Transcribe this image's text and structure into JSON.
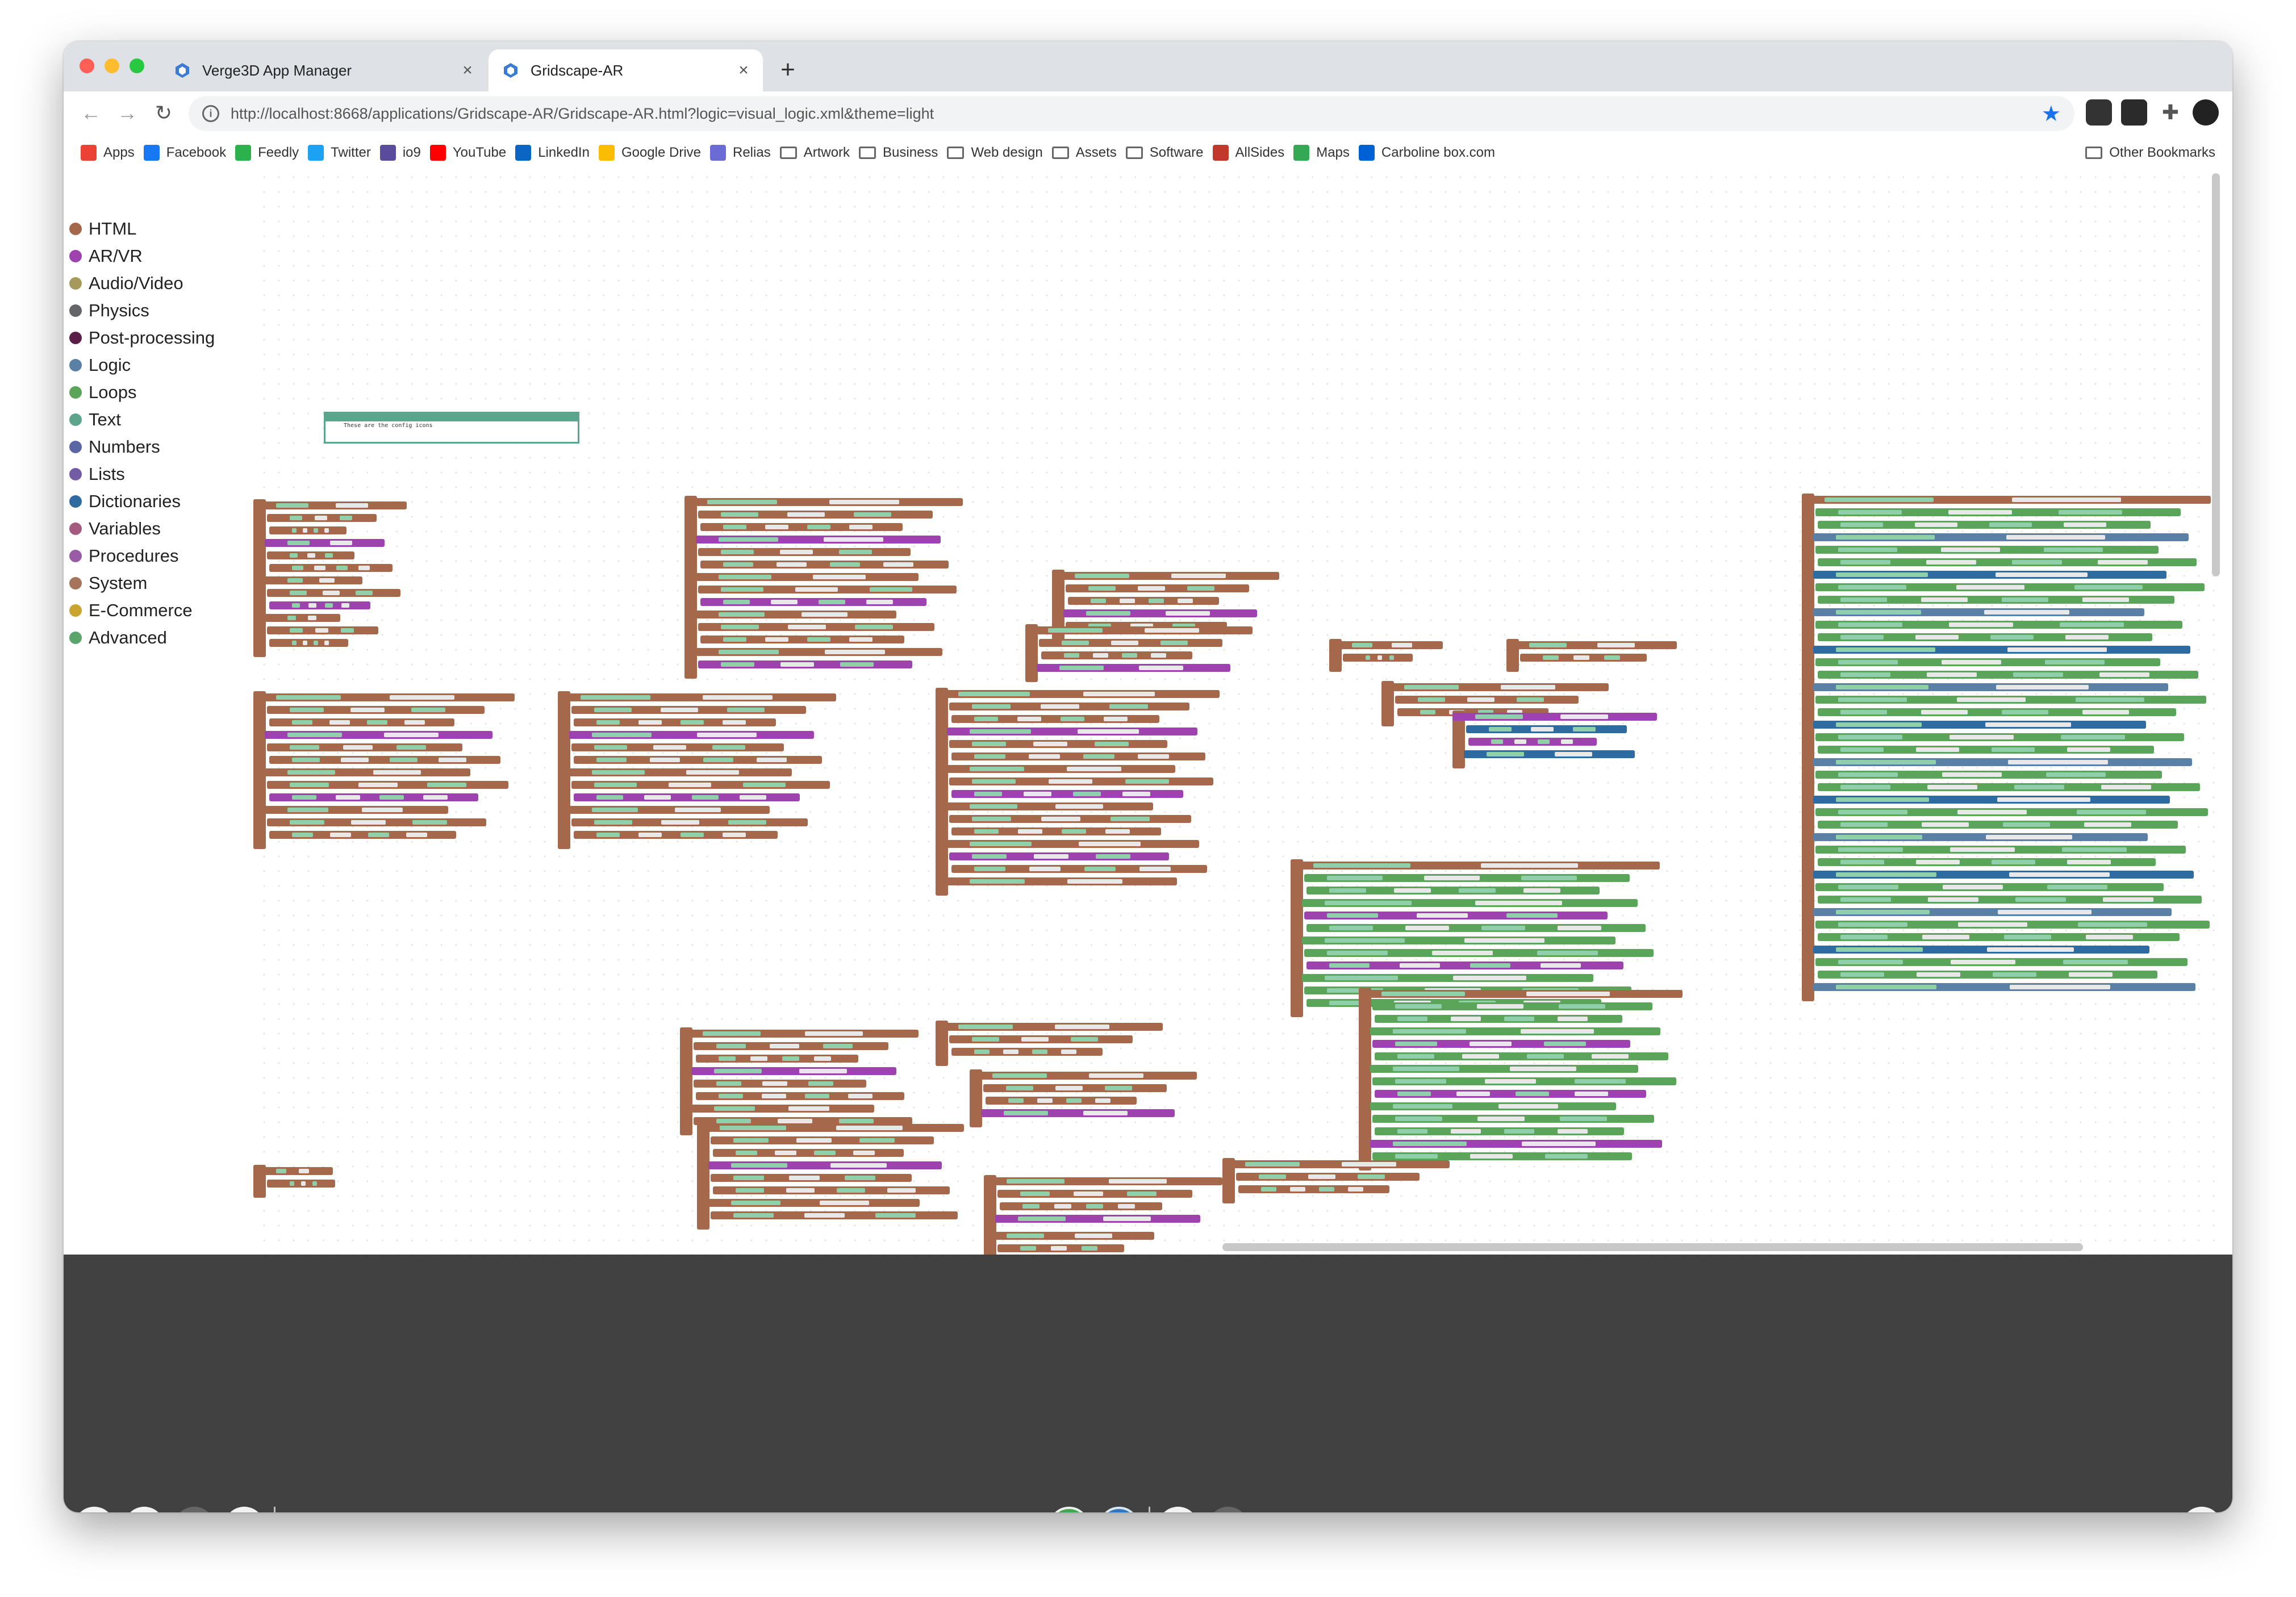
{
  "tabs": [
    {
      "title": "Verge3D App Manager",
      "close": "×"
    },
    {
      "title": "Gridscape-AR",
      "close": "×"
    }
  ],
  "new_tab": "+",
  "address_bar": {
    "url": "http://localhost:8668/applications/Gridscape-AR/Gridscape-AR.html?logic=visual_logic.xml&theme=light"
  },
  "bookmarks": [
    {
      "label": "Apps",
      "color": "#ea4335"
    },
    {
      "label": "Facebook",
      "color": "#1877f2"
    },
    {
      "label": "Feedly",
      "color": "#2bb24c"
    },
    {
      "label": "Twitter",
      "color": "#1da1f2"
    },
    {
      "label": "io9",
      "color": "#5b4b9c"
    },
    {
      "label": "YouTube",
      "color": "#ff0000"
    },
    {
      "label": "LinkedIn",
      "color": "#0a66c2"
    },
    {
      "label": "Google Drive",
      "color": "#fbbc04"
    },
    {
      "label": "Relias",
      "color": "#6b6bd6"
    },
    {
      "label": "Artwork",
      "folder": true
    },
    {
      "label": "Business",
      "folder": true
    },
    {
      "label": "Web design",
      "folder": true
    },
    {
      "label": "Assets",
      "folder": true
    },
    {
      "label": "Software",
      "folder": true
    },
    {
      "label": "AllSides",
      "color": "#c0392b"
    },
    {
      "label": "Maps",
      "color": "#34a853"
    },
    {
      "label": "Carboline box.com",
      "color": "#0061d5"
    }
  ],
  "other_bookmarks": "Other Bookmarks",
  "categories": [
    {
      "label": "HTML",
      "color": "#a5684b"
    },
    {
      "label": "AR/VR",
      "color": "#9e42b0"
    },
    {
      "label": "Audio/Video",
      "color": "#a59a5b"
    },
    {
      "label": "Physics",
      "color": "#64656a"
    },
    {
      "label": "Post-processing",
      "color": "#5a1e49"
    },
    {
      "label": "Logic",
      "color": "#5b80a5"
    },
    {
      "label": "Loops",
      "color": "#5ba55b"
    },
    {
      "label": "Text",
      "color": "#5ba58c"
    },
    {
      "label": "Numbers",
      "color": "#5b67a5"
    },
    {
      "label": "Lists",
      "color": "#745ba5"
    },
    {
      "label": "Dictionaries",
      "color": "#2e6ba0"
    },
    {
      "label": "Variables",
      "color": "#a55b80"
    },
    {
      "label": "Procedures",
      "color": "#995ba5"
    },
    {
      "label": "System",
      "color": "#a5745b"
    },
    {
      "label": "E-Commerce",
      "color": "#c9a42e"
    },
    {
      "label": "Advanced",
      "color": "#5ba56a"
    }
  ],
  "workspace_comment": "These are the config icons",
  "block_colors": {
    "html": "#a5684b",
    "text": "#5ba58c",
    "logic": "#5b80a5",
    "loops": "#5ba55b",
    "procedure": "#9e42b0",
    "dict": "#2e6ba0"
  },
  "bottom_toolbar": {
    "left_buttons": [
      "file-icon",
      "panel-icon",
      "camera-icon",
      "crosshair-icon"
    ],
    "center_buttons": [
      "play-icon",
      "save-icon",
      "undo-icon",
      "redo-icon"
    ],
    "help": "?"
  }
}
